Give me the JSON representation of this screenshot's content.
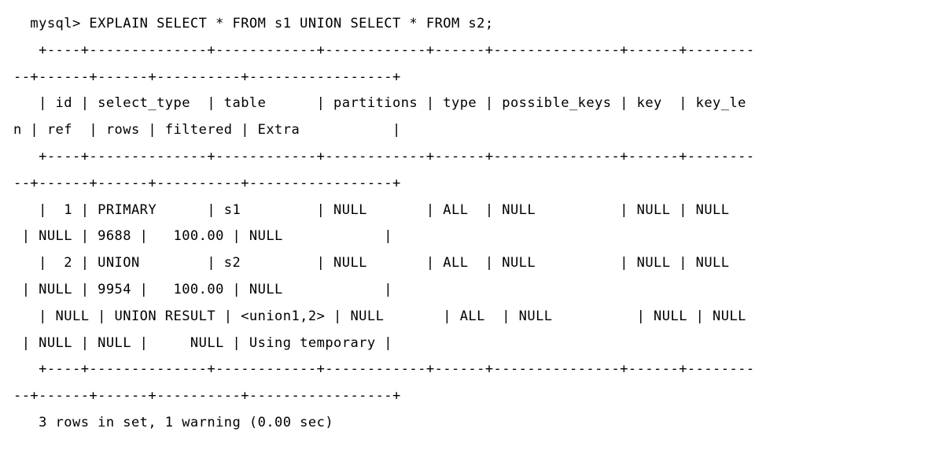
{
  "terminal": {
    "app": "mysql-client",
    "prompt": "mysql>",
    "query": "EXPLAIN SELECT * FROM s1 UNION SELECT * FROM s2;",
    "columns": [
      "id",
      "select_type",
      "table",
      "partitions",
      "type",
      "possible_keys",
      "key",
      "key_len",
      "ref",
      "rows",
      "filtered",
      "Extra"
    ],
    "rows": [
      {
        "id": "1",
        "select_type": "PRIMARY",
        "table": "s1",
        "partitions": "NULL",
        "type": "ALL",
        "possible_keys": "NULL",
        "key": "NULL",
        "key_len": "NULL",
        "ref": "NULL",
        "rows": "9688",
        "filtered": "100.00",
        "Extra": "NULL"
      },
      {
        "id": "2",
        "select_type": "UNION",
        "table": "s2",
        "partitions": "NULL",
        "type": "ALL",
        "possible_keys": "NULL",
        "key": "NULL",
        "key_len": "NULL",
        "ref": "NULL",
        "rows": "9954",
        "filtered": "100.00",
        "Extra": "NULL"
      },
      {
        "id": "NULL",
        "select_type": "UNION RESULT",
        "table": "<union1,2>",
        "partitions": "NULL",
        "type": "ALL",
        "possible_keys": "NULL",
        "key": "NULL",
        "key_len": "NULL",
        "ref": "NULL",
        "rows": "NULL",
        "filtered": "NULL",
        "Extra": "Using temporary"
      }
    ],
    "status": "3 rows in set, 1 warning (0.00 sec)",
    "lines": [
      "  mysql> EXPLAIN SELECT * FROM s1 UNION SELECT * FROM s2;",
      "   +----+--------------+------------+------------+------+---------------+------+--------",
      "--+------+------+----------+-----------------+",
      "   | id | select_type  | table      | partitions | type | possible_keys | key  | key_le",
      "n | ref  | rows | filtered | Extra           |",
      "   +----+--------------+------------+------------+------+---------------+------+--------",
      "--+------+------+----------+-----------------+",
      "   |  1 | PRIMARY      | s1         | NULL       | ALL  | NULL          | NULL | NULL  ",
      " | NULL | 9688 |   100.00 | NULL            |",
      "   |  2 | UNION        | s2         | NULL       | ALL  | NULL          | NULL | NULL  ",
      " | NULL | 9954 |   100.00 | NULL            |",
      "   | NULL | UNION RESULT | <union1,2> | NULL       | ALL  | NULL          | NULL | NULL ",
      " | NULL | NULL |     NULL | Using temporary |",
      "   +----+--------------+------------+------------+------+---------------+------+--------",
      "--+------+------+----------+-----------------+",
      "   3 rows in set, 1 warning (0.00 sec)"
    ],
    "colors": {
      "background": "#ffffff",
      "foreground": "#000000"
    }
  }
}
